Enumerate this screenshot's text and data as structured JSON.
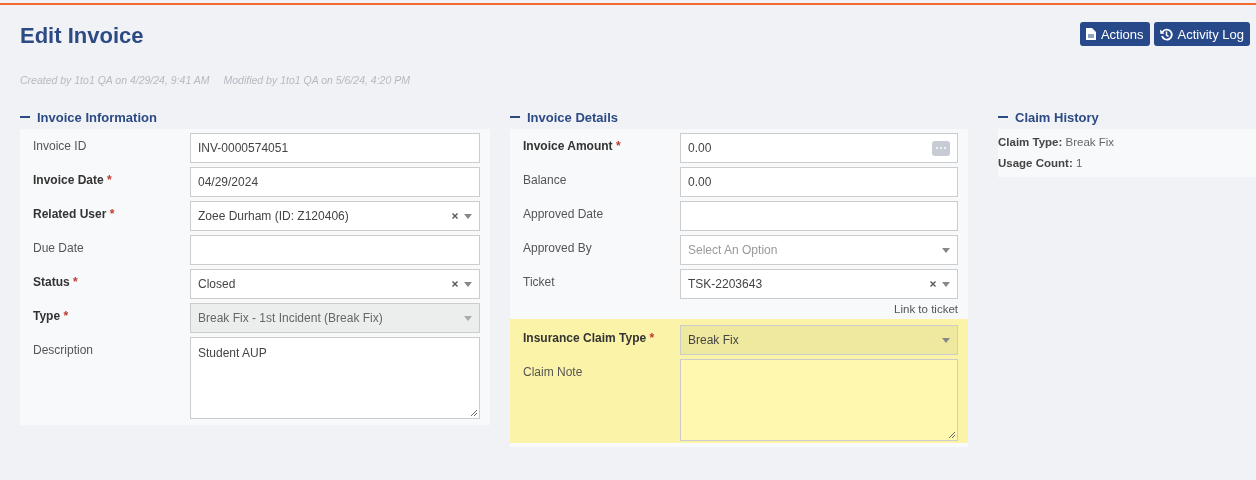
{
  "header": {
    "title": "Edit Invoice",
    "actions": [
      {
        "label": "Actions"
      },
      {
        "label": "Activity Log"
      }
    ],
    "meta": [
      "Created by 1to1 QA on 4/29/24, 9:41 AM",
      "Modified by 1to1 QA on 5/6/24, 4:20 PM"
    ]
  },
  "sections": [
    {
      "title": "Invoice Information",
      "fields": [
        {
          "kind": "text",
          "label": "Invoice ID",
          "value": "INV-0000574051",
          "disabled": false,
          "highlighted": false
        },
        {
          "kind": "text",
          "label": "Invoice Date",
          "required_mark": "*",
          "value": "04/29/2024",
          "disabled": false,
          "highlighted": false
        },
        {
          "kind": "select",
          "label": "Related User",
          "required_mark": "*",
          "value": "Zoee Durham (ID: Z120406)",
          "clearable": true,
          "disabled": false,
          "highlighted": false
        },
        {
          "kind": "text",
          "label": "Due Date",
          "disabled": false,
          "highlighted": false
        },
        {
          "kind": "select",
          "label": "Status",
          "required_mark": "*",
          "value": "Closed",
          "clearable": true,
          "disabled": false,
          "highlighted": false
        },
        {
          "kind": "select",
          "label": "Type",
          "required_mark": "*",
          "value": "Break Fix - 1st Incident (Break Fix)",
          "clearable": false,
          "disabled": true,
          "highlighted": false
        },
        {
          "kind": "textarea",
          "label": "Description",
          "value": "Student AUP",
          "disabled": false,
          "highlighted": false
        }
      ]
    },
    {
      "title": "Invoice Details",
      "fields": [
        {
          "kind": "picker",
          "label": "Invoice Amount",
          "required_mark": "*",
          "value": "0.00",
          "disabled": false,
          "highlighted": false
        },
        {
          "kind": "text",
          "label": "Balance",
          "value": "0.00",
          "disabled": false,
          "highlighted": false
        },
        {
          "kind": "text",
          "label": "Approved Date",
          "disabled": false,
          "highlighted": false
        },
        {
          "kind": "select",
          "label": "Approved By",
          "placeholder": "Select An Option",
          "clearable": false,
          "disabled": false,
          "highlighted": false
        },
        {
          "kind": "select",
          "label": "Ticket",
          "value": "TSK-2203643",
          "clearable": true,
          "link": "Link to ticket",
          "disabled": false,
          "highlighted": false
        },
        {
          "kind": "select",
          "label": "Insurance Claim Type",
          "required_mark": "*",
          "value": "Break Fix",
          "clearable": false,
          "disabled": false,
          "highlighted": true
        },
        {
          "kind": "textarea",
          "label": "Claim Note",
          "disabled": false,
          "highlighted": true
        }
      ]
    }
  ],
  "claim_history": {
    "title": "Claim History",
    "items": [
      {
        "label": "Claim Type:",
        "value": "Break Fix"
      },
      {
        "label": "Usage Count:",
        "value": "1"
      }
    ]
  }
}
